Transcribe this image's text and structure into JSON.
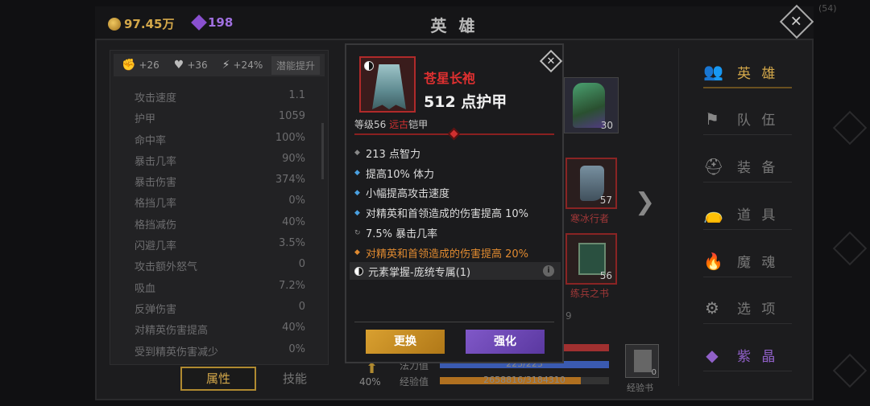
{
  "currency": {
    "gold": "97.45万",
    "gems": "198"
  },
  "screen_title": "英 雄",
  "corner_text": "(54)",
  "stats_panel": {
    "buffs": [
      "+26",
      "+36",
      "+24%"
    ],
    "potential_button": "潜能提升",
    "rows": [
      {
        "label": "攻击速度",
        "value": "1.1"
      },
      {
        "label": "护甲",
        "value": "1059"
      },
      {
        "label": "命中率",
        "value": "100%"
      },
      {
        "label": "暴击几率",
        "value": "90%"
      },
      {
        "label": "暴击伤害",
        "value": "374%"
      },
      {
        "label": "格挡几率",
        "value": "0%"
      },
      {
        "label": "格挡减伤",
        "value": "40%"
      },
      {
        "label": "闪避几率",
        "value": "3.5%"
      },
      {
        "label": "攻击额外怒气",
        "value": "0"
      },
      {
        "label": "吸血",
        "value": "7.2%"
      },
      {
        "label": "反弹伤害",
        "value": "0"
      },
      {
        "label": "对精英伤害提高",
        "value": "40%"
      },
      {
        "label": "受到精英伤害减少",
        "value": "0%"
      }
    ],
    "tabs": {
      "attributes": "属性",
      "skills": "技能"
    }
  },
  "background": {
    "hero_level": "30",
    "slots": [
      {
        "name": "寒冰行者",
        "level": "57"
      },
      {
        "name": "练兵之书",
        "level": "56"
      }
    ],
    "bars": {
      "mana_label": "法力值",
      "mana_value": "223/223",
      "mana_fraction": 1.0,
      "exp_label": "经验值",
      "exp_value": "2658816/3184310",
      "exp_fraction": 0.835,
      "percent": "40%"
    },
    "exp_book": {
      "label": "经验书",
      "count": "0"
    },
    "partial_number": "9"
  },
  "nav": [
    {
      "label": "英 雄",
      "icon": "users-icon",
      "glyph": "👥"
    },
    {
      "label": "队 伍",
      "icon": "flag-icon",
      "glyph": "⚑"
    },
    {
      "label": "装 备",
      "icon": "helmet-icon",
      "glyph": "⛑"
    },
    {
      "label": "道 具",
      "icon": "bag-icon",
      "glyph": "👝"
    },
    {
      "label": "魔 魂",
      "icon": "fire-icon",
      "glyph": "🔥"
    },
    {
      "label": "选 项",
      "icon": "gear-icon",
      "glyph": "⚙"
    },
    {
      "label": "紫 晶",
      "icon": "crystal-icon",
      "glyph": "◆"
    }
  ],
  "modal": {
    "item_name": "苍星长袍",
    "armor_text": "512 点护甲",
    "requirement_prefix": "等级56 ",
    "requirement_class": "远古",
    "requirement_suffix": "铠甲",
    "attributes": [
      {
        "text": "213 点智力",
        "bullet": "◆",
        "style": "gray"
      },
      {
        "text": "提高10% 体力",
        "bullet": "◆",
        "style": "blue"
      },
      {
        "text": "小幅提高攻击速度",
        "bullet": "◆",
        "style": "blue"
      },
      {
        "text": "对精英和首领造成的伤害提高 10%",
        "bullet": "◆",
        "style": "blue"
      },
      {
        "text": "7.5% 暴击几率",
        "bullet": "↻",
        "style": "gray"
      },
      {
        "text": "对精英和首领造成的伤害提高 20%",
        "bullet": "◆",
        "style": "orange"
      }
    ],
    "set_bonus": "元素掌握-庞统专属(1)",
    "buttons": {
      "swap": "更换",
      "enhance": "强化"
    }
  },
  "colors": {
    "gold": "#d4a84a",
    "purple": "#9060c8",
    "legendary_red": "#e03030",
    "set_orange": "#e08a30",
    "affix_blue": "#4aa0e0"
  }
}
